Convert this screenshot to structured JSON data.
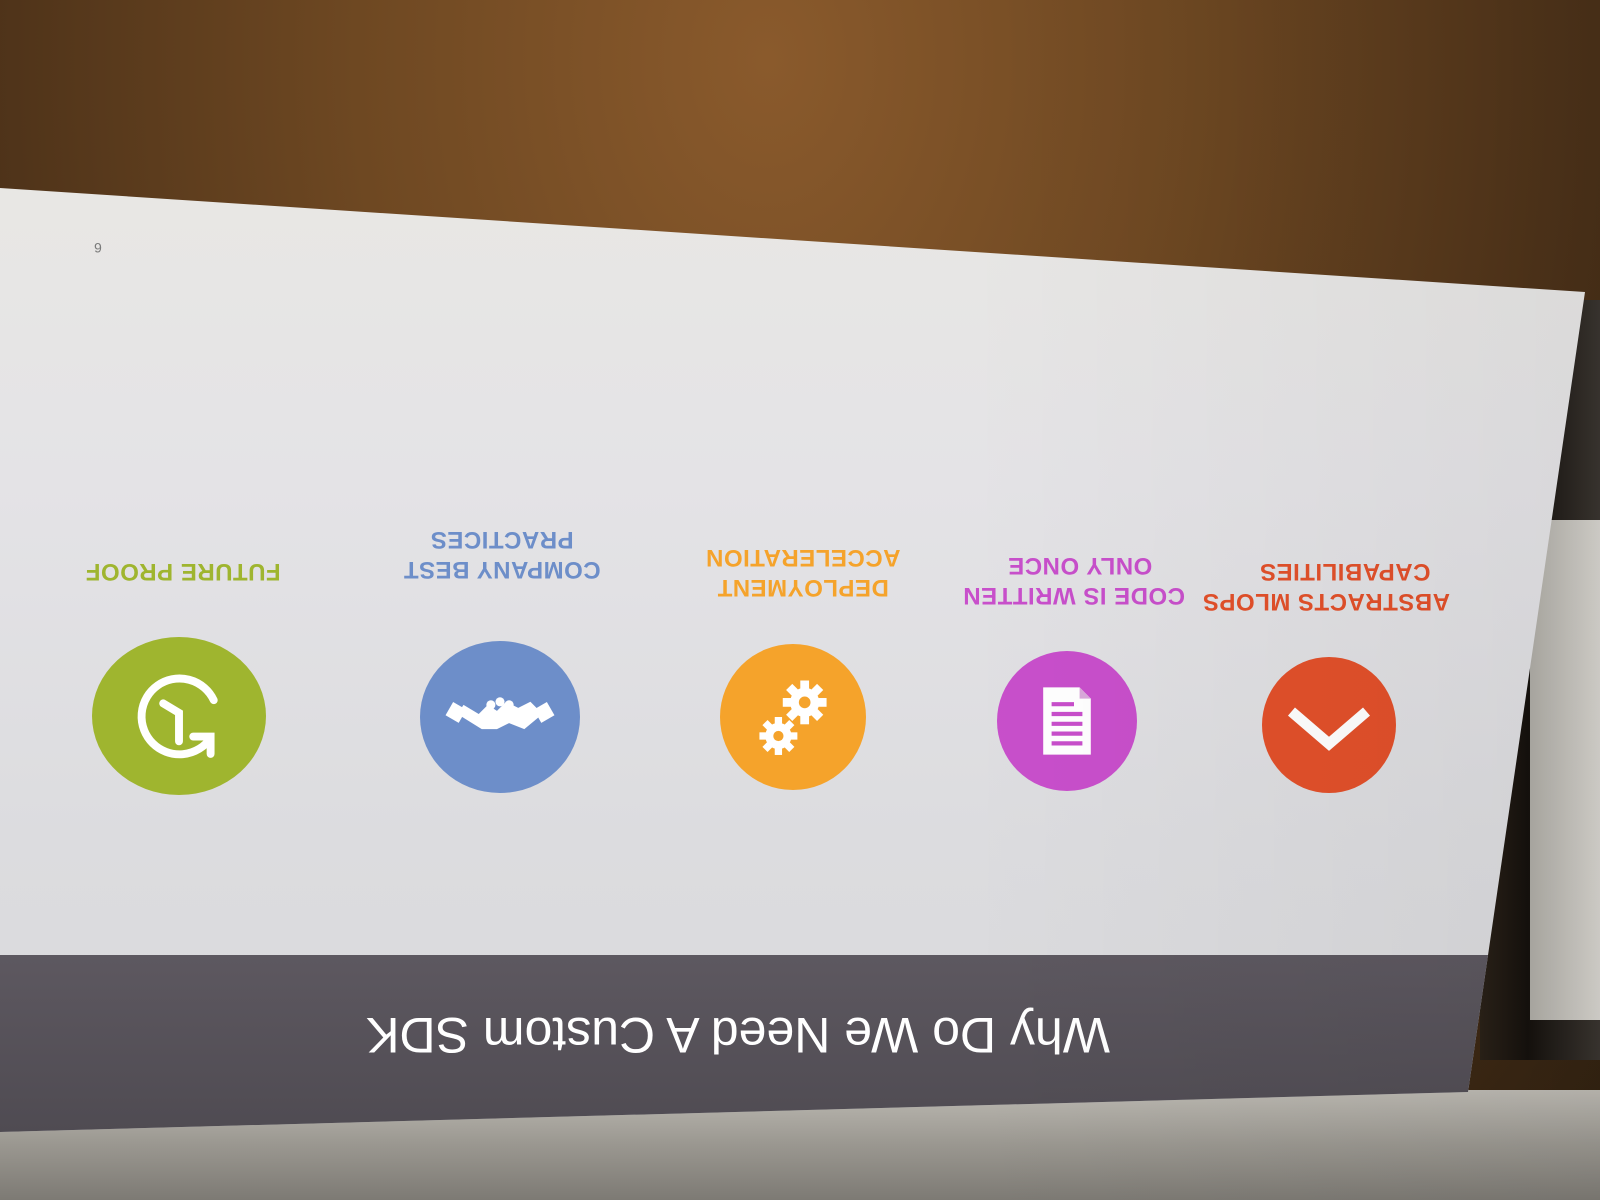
{
  "slide": {
    "title": "Why Do We Need A Custom SDK",
    "number": "6"
  },
  "items": [
    {
      "line1": "ABSTRACTS MLOPS",
      "line2": "CAPABILITIES",
      "color": "#e2502a",
      "icon": "chevron-icon"
    },
    {
      "line1": "CODE IS WRITTEN",
      "line2": "ONLY ONCE",
      "color": "#c84fcb",
      "icon": "document-icon"
    },
    {
      "line1": "DEPLOYMENT",
      "line2": "ACCELERATION",
      "color": "#f5a32b",
      "icon": "gears-icon"
    },
    {
      "line1": "COMPANY BEST",
      "line2": "PRACTICES",
      "color": "#6d8ec9",
      "icon": "handshake-icon"
    },
    {
      "line1": "FUTURE PROOF",
      "line2": "",
      "color": "#9fb52f",
      "icon": "history-clock-icon"
    }
  ]
}
